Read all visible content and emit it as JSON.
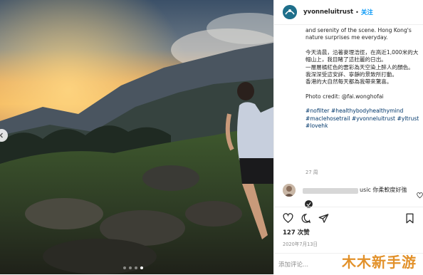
{
  "post": {
    "username": "yvonneluitrust",
    "separator": "•",
    "follow_label": "关注"
  },
  "caption": {
    "english": "and serenity of the scene. Hong Kong's nature surprises me everyday.",
    "chinese_lines": [
      "今天清晨，沿著麥理浩徑，在高近1,000米的大帽山上，我目睹了這壯麗的日出。",
      "一層層橘紅色的雲彩為天空染上醉人的顏色。",
      "我深深受這安詳、寧靜的景致所打動。",
      "香港的大自然每天都為我帶來驚喜。"
    ],
    "credit": "Photo credit: @fai.wonghofai",
    "hashtags": [
      "#nofilter",
      "#healthybodyhealthymind",
      "#maclehosetrail",
      "#yvonneluitrust",
      "#yltrust",
      "#lovehk"
    ],
    "time_ago": "27 周"
  },
  "comment": {
    "text": "usic 你柔軟度好強"
  },
  "stats": {
    "likes": "127 次赞",
    "date": "2020年7月13日"
  },
  "composer": {
    "placeholder": "添加评论..."
  },
  "watermark": "木木新手游",
  "carousel": {
    "total": 4,
    "active_index": 3
  },
  "colors": {
    "link": "#00376b",
    "follow": "#0095f6",
    "muted": "#8e8e8e",
    "watermark": "#e2912a"
  }
}
